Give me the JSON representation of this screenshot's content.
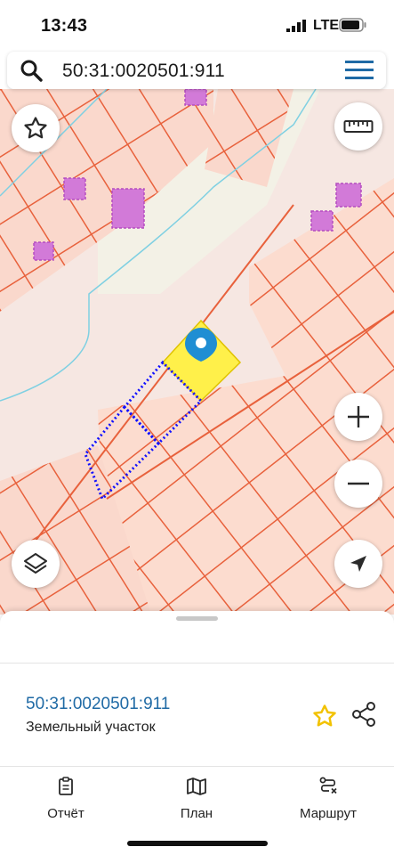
{
  "status_bar": {
    "time": "13:43",
    "network": "LTE"
  },
  "search": {
    "query": "50:31:0020501:911",
    "icon": "search-icon",
    "menu_icon": "hamburger-menu-icon"
  },
  "map": {
    "buttons": {
      "favorite": "star-outline-icon",
      "ruler": "ruler-icon",
      "zoom_in": "plus-icon",
      "zoom_out": "minus-icon",
      "layers": "layers-icon",
      "location": "navigation-arrow-icon"
    },
    "marker_icon": "map-pin-icon",
    "colors": {
      "selected_parcel": "#fff04a",
      "parcel_border": "#e8613c",
      "parcel_fill": "#fcdccf",
      "building": "#d27ad8",
      "water_line": "#7fd0e2",
      "dotted_boundary": "#1010ff"
    }
  },
  "sheet": {
    "parcel_id": "50:31:0020501:911",
    "parcel_type": "Земельный участок",
    "favorite_icon": "star-icon",
    "share_icon": "share-icon",
    "accent_color": "#f2c200"
  },
  "tabs": [
    {
      "label": "Отчёт",
      "icon": "report-icon"
    },
    {
      "label": "План",
      "icon": "map-icon"
    },
    {
      "label": "Маршрут",
      "icon": "route-icon"
    }
  ]
}
